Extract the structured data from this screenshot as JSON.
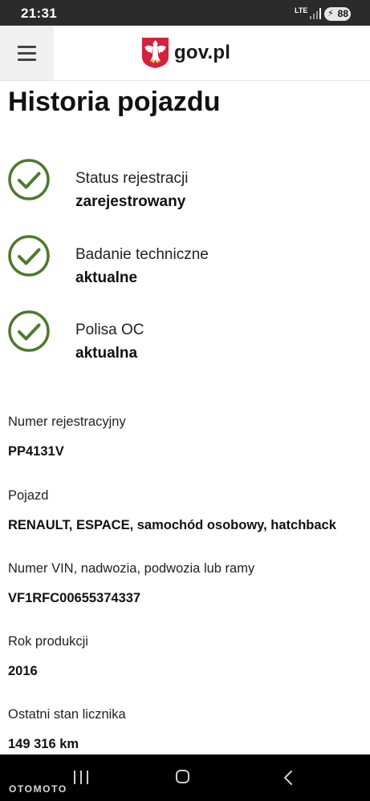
{
  "status_bar": {
    "time": "21:31",
    "network": "LTE",
    "battery": "88"
  },
  "header": {
    "menu_icon": "hamburger-menu-icon",
    "logo_icon": "polish-eagle-emblem-icon",
    "logo_text": "gov.pl"
  },
  "page": {
    "title": "Historia pojazdu"
  },
  "statuses": [
    {
      "label": "Status rejestracji",
      "value": "zarejestrowany",
      "icon": "check-circle-icon"
    },
    {
      "label": "Badanie techniczne",
      "value": "aktualne",
      "icon": "check-circle-icon"
    },
    {
      "label": "Polisa OC",
      "value": "aktualna",
      "icon": "check-circle-icon"
    }
  ],
  "fields": [
    {
      "label": "Numer rejestracyjny",
      "value": "PP4131V"
    },
    {
      "label": "Pojazd",
      "value": "RENAULT, ESPACE, samochód osobowy, hatchback"
    },
    {
      "label": "Numer VIN, nadwozia, podwozia lub ramy",
      "value": "VF1RFC00655374337"
    },
    {
      "label": "Rok produkcji",
      "value": "2016"
    },
    {
      "label": "Ostatni stan licznika",
      "value": "149 316 km"
    }
  ],
  "nav_bar": {
    "watermark": "OTOMOTO"
  },
  "colors": {
    "check": "#4e7a2d",
    "status_bar": "#2b2b2b",
    "menu_bg": "#f0f0f0",
    "emblem_red": "#d4213d"
  }
}
